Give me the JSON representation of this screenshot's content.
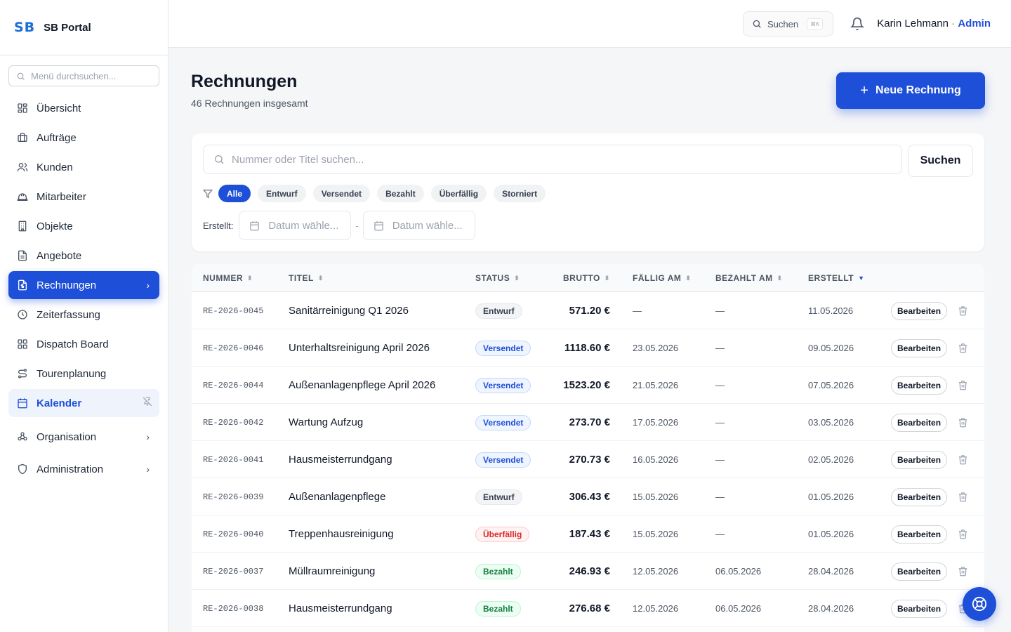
{
  "brand": {
    "logo": "SB",
    "name": "SB Portal"
  },
  "sidebar": {
    "search_placeholder": "Menü durchsuchen...",
    "items": [
      {
        "label": "Übersicht",
        "icon": "grid-icon"
      },
      {
        "label": "Aufträge",
        "icon": "briefcase-icon"
      },
      {
        "label": "Kunden",
        "icon": "users-icon"
      },
      {
        "label": "Mitarbeiter",
        "icon": "hardhat-icon"
      },
      {
        "label": "Objekte",
        "icon": "building-icon"
      },
      {
        "label": "Angebote",
        "icon": "document-icon"
      },
      {
        "label": "Rechnungen",
        "icon": "invoice-icon",
        "active": true
      },
      {
        "label": "Zeiterfassung",
        "icon": "clock-icon"
      },
      {
        "label": "Dispatch Board",
        "icon": "grid-icon"
      },
      {
        "label": "Tourenplanung",
        "icon": "route-icon"
      },
      {
        "label": "Kalender",
        "icon": "calendar-icon"
      }
    ],
    "groups": [
      {
        "label": "Organisation",
        "icon": "organization-icon"
      },
      {
        "label": "Administration",
        "icon": "shield-icon"
      }
    ]
  },
  "topbar": {
    "search_label": "Suchen",
    "shortcut": "⌘K",
    "user_name": "Karin Lehmann",
    "separator": " · ",
    "user_role": "Admin"
  },
  "page": {
    "title": "Rechnungen",
    "subtitle": "46 Rechnungen insgesamt",
    "new_button": "Neue Rechnung"
  },
  "filters": {
    "search_placeholder": "Nummer oder Titel suchen...",
    "search_button": "Suchen",
    "chips": [
      "Alle",
      "Entwurf",
      "Versendet",
      "Bezahlt",
      "Überfällig",
      "Storniert"
    ],
    "active_chip": "Alle",
    "created_label": "Erstellt:",
    "date_placeholder_from": "Datum wähle...",
    "date_placeholder_to": "Datum wähle...",
    "date_separator": "-"
  },
  "table": {
    "columns": [
      "NUMMER",
      "TITEL",
      "STATUS",
      "BRUTTO",
      "FÄLLIG AM",
      "BEZAHLT AM",
      "ERSTELLT"
    ],
    "edit_label": "Bearbeiten",
    "rows": [
      {
        "nummer": "RE-2026-0045",
        "titel": "Sanitärreinigung Q1 2026",
        "status": "Entwurf",
        "brutto": "571.20 €",
        "faellig": "—",
        "bezahlt": "—",
        "erstellt": "11.05.2026"
      },
      {
        "nummer": "RE-2026-0046",
        "titel": "Unterhaltsreinigung April 2026",
        "status": "Versendet",
        "brutto": "1118.60 €",
        "faellig": "23.05.2026",
        "bezahlt": "—",
        "erstellt": "09.05.2026"
      },
      {
        "nummer": "RE-2026-0044",
        "titel": "Außenanlagenpflege April 2026",
        "status": "Versendet",
        "brutto": "1523.20 €",
        "faellig": "21.05.2026",
        "bezahlt": "—",
        "erstellt": "07.05.2026"
      },
      {
        "nummer": "RE-2026-0042",
        "titel": "Wartung Aufzug",
        "status": "Versendet",
        "brutto": "273.70 €",
        "faellig": "17.05.2026",
        "bezahlt": "—",
        "erstellt": "03.05.2026"
      },
      {
        "nummer": "RE-2026-0041",
        "titel": "Hausmeisterrundgang",
        "status": "Versendet",
        "brutto": "270.73 €",
        "faellig": "16.05.2026",
        "bezahlt": "—",
        "erstellt": "02.05.2026"
      },
      {
        "nummer": "RE-2026-0039",
        "titel": "Außenanlagenpflege",
        "status": "Entwurf",
        "brutto": "306.43 €",
        "faellig": "15.05.2026",
        "bezahlt": "—",
        "erstellt": "01.05.2026"
      },
      {
        "nummer": "RE-2026-0040",
        "titel": "Treppenhausreinigung",
        "status": "Überfällig",
        "brutto": "187.43 €",
        "faellig": "15.05.2026",
        "bezahlt": "—",
        "erstellt": "01.05.2026"
      },
      {
        "nummer": "RE-2026-0037",
        "titel": "Müllraumreinigung",
        "status": "Bezahlt",
        "brutto": "246.93 €",
        "faellig": "12.05.2026",
        "bezahlt": "06.05.2026",
        "erstellt": "28.04.2026"
      },
      {
        "nummer": "RE-2026-0038",
        "titel": "Hausmeisterrundgang",
        "status": "Bezahlt",
        "brutto": "276.68 €",
        "faellig": "12.05.2026",
        "bezahlt": "06.05.2026",
        "erstellt": "28.04.2026"
      }
    ]
  },
  "colors": {
    "accent": "#1e4fd8",
    "brand": "#1d6fd8"
  }
}
